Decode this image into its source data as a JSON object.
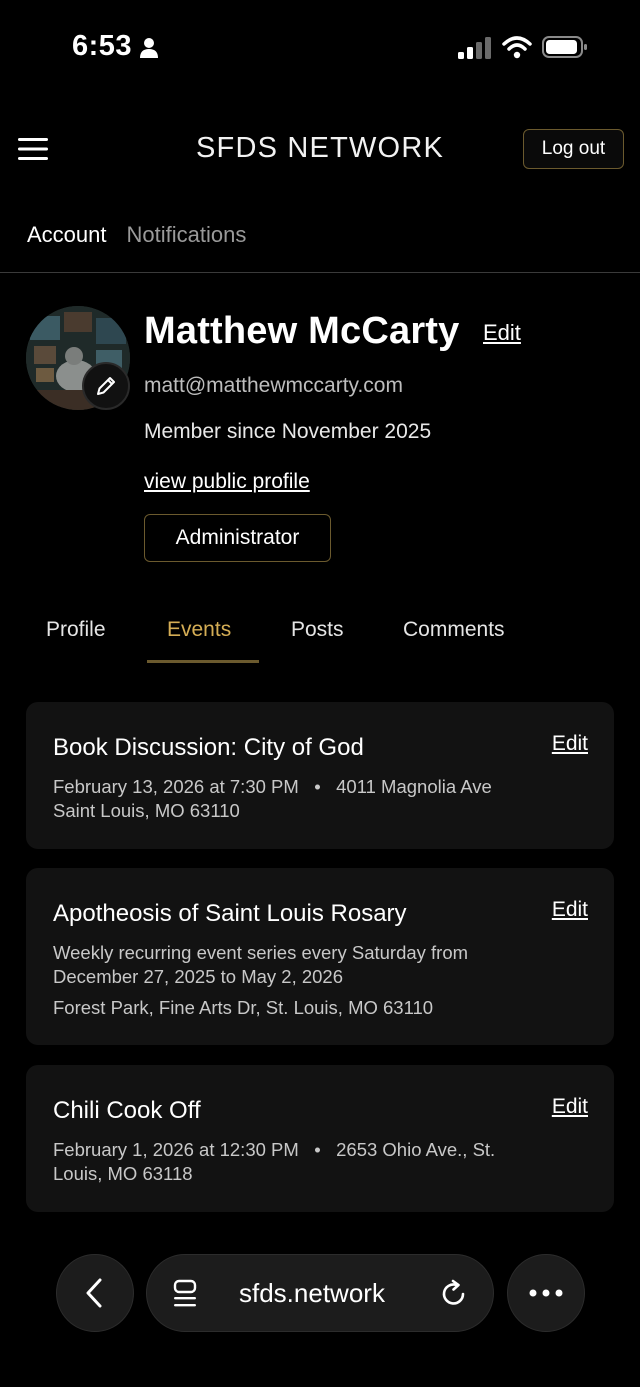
{
  "status_bar": {
    "time": "6:53"
  },
  "header": {
    "title": "SFDS NETWORK",
    "logout_label": "Log out"
  },
  "account_tabs": [
    {
      "label": "Account",
      "active": true
    },
    {
      "label": "Notifications",
      "active": false
    }
  ],
  "profile": {
    "name": "Matthew McCarty",
    "edit_label": "Edit",
    "email": "matt@matthewmccarty.com",
    "member_since": "Member since November 2025",
    "public_profile_link": "view public profile",
    "role": "Administrator"
  },
  "content_tabs": [
    {
      "label": "Profile",
      "active": false
    },
    {
      "label": "Events",
      "active": true
    },
    {
      "label": "Posts",
      "active": false
    },
    {
      "label": "Comments",
      "active": false
    }
  ],
  "events": [
    {
      "title": "Book Discussion: City of God",
      "edit_label": "Edit",
      "when": "February 13, 2026 at 7:30 PM",
      "where": "4011 Magnolia Ave Saint Louis, MO 63110"
    },
    {
      "title": "Apotheosis of Saint Louis Rosary",
      "edit_label": "Edit",
      "recurrence": "Weekly recurring event series every Saturday from December 27, 2025 to May 2, 2026",
      "where": "Forest Park, Fine Arts Dr, St. Louis, MO 63110"
    },
    {
      "title": "Chili Cook Off",
      "edit_label": "Edit",
      "when": "February 1, 2026 at 12:30 PM",
      "where": "2653 Ohio Ave., St. Louis, MO 63118"
    }
  ],
  "browser": {
    "url": "sfds.network"
  },
  "colors": {
    "accent": "#d4ad55",
    "accent_border": "#6b5a2e",
    "card_bg": "#121212",
    "page_bg": "#000000"
  }
}
